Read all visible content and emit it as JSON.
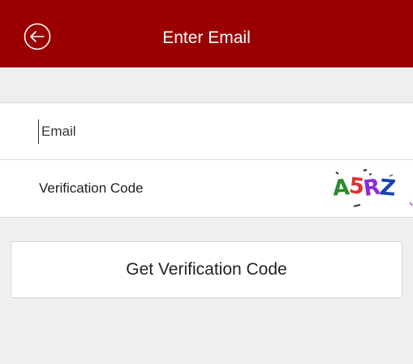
{
  "header": {
    "title": "Enter Email",
    "back_icon": "back-arrow-circle-icon",
    "background_color": "#9b0000"
  },
  "form": {
    "email": {
      "placeholder": "Email",
      "value": ""
    },
    "verification": {
      "label": "Verification Code",
      "captcha_text": "A5RZ",
      "captcha_chars": [
        "A",
        "5",
        "R",
        "Z"
      ],
      "captcha_colors": [
        "#2e8b2e",
        "#e03030",
        "#8a2be2",
        "#1b3fae"
      ]
    }
  },
  "actions": {
    "get_code_label": "Get Verification Code"
  }
}
